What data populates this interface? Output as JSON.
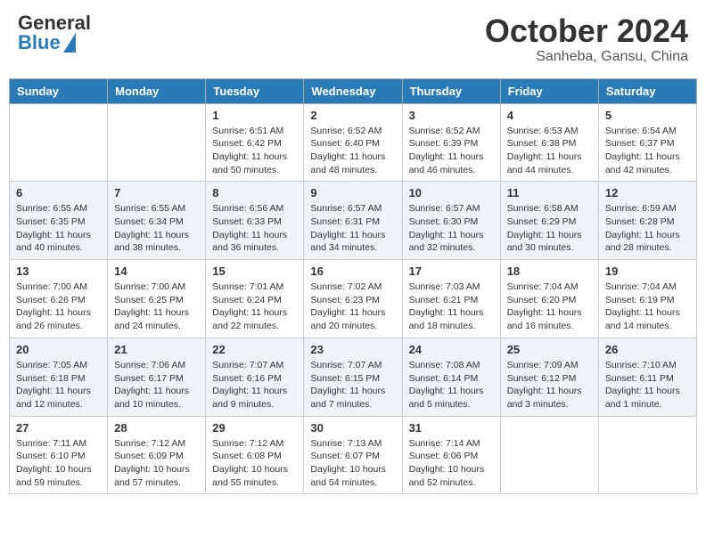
{
  "header": {
    "logo_general": "General",
    "logo_blue": "Blue",
    "month_title": "October 2024",
    "location": "Sanheba, Gansu, China"
  },
  "days_of_week": [
    "Sunday",
    "Monday",
    "Tuesday",
    "Wednesday",
    "Thursday",
    "Friday",
    "Saturday"
  ],
  "weeks": [
    [
      {
        "day": "",
        "info": ""
      },
      {
        "day": "",
        "info": ""
      },
      {
        "day": "1",
        "info": "Sunrise: 6:51 AM\nSunset: 6:42 PM\nDaylight: 11 hours and 50 minutes."
      },
      {
        "day": "2",
        "info": "Sunrise: 6:52 AM\nSunset: 6:40 PM\nDaylight: 11 hours and 48 minutes."
      },
      {
        "day": "3",
        "info": "Sunrise: 6:52 AM\nSunset: 6:39 PM\nDaylight: 11 hours and 46 minutes."
      },
      {
        "day": "4",
        "info": "Sunrise: 6:53 AM\nSunset: 6:38 PM\nDaylight: 11 hours and 44 minutes."
      },
      {
        "day": "5",
        "info": "Sunrise: 6:54 AM\nSunset: 6:37 PM\nDaylight: 11 hours and 42 minutes."
      }
    ],
    [
      {
        "day": "6",
        "info": "Sunrise: 6:55 AM\nSunset: 6:35 PM\nDaylight: 11 hours and 40 minutes."
      },
      {
        "day": "7",
        "info": "Sunrise: 6:55 AM\nSunset: 6:34 PM\nDaylight: 11 hours and 38 minutes."
      },
      {
        "day": "8",
        "info": "Sunrise: 6:56 AM\nSunset: 6:33 PM\nDaylight: 11 hours and 36 minutes."
      },
      {
        "day": "9",
        "info": "Sunrise: 6:57 AM\nSunset: 6:31 PM\nDaylight: 11 hours and 34 minutes."
      },
      {
        "day": "10",
        "info": "Sunrise: 6:57 AM\nSunset: 6:30 PM\nDaylight: 11 hours and 32 minutes."
      },
      {
        "day": "11",
        "info": "Sunrise: 6:58 AM\nSunset: 6:29 PM\nDaylight: 11 hours and 30 minutes."
      },
      {
        "day": "12",
        "info": "Sunrise: 6:59 AM\nSunset: 6:28 PM\nDaylight: 11 hours and 28 minutes."
      }
    ],
    [
      {
        "day": "13",
        "info": "Sunrise: 7:00 AM\nSunset: 6:26 PM\nDaylight: 11 hours and 26 minutes."
      },
      {
        "day": "14",
        "info": "Sunrise: 7:00 AM\nSunset: 6:25 PM\nDaylight: 11 hours and 24 minutes."
      },
      {
        "day": "15",
        "info": "Sunrise: 7:01 AM\nSunset: 6:24 PM\nDaylight: 11 hours and 22 minutes."
      },
      {
        "day": "16",
        "info": "Sunrise: 7:02 AM\nSunset: 6:23 PM\nDaylight: 11 hours and 20 minutes."
      },
      {
        "day": "17",
        "info": "Sunrise: 7:03 AM\nSunset: 6:21 PM\nDaylight: 11 hours and 18 minutes."
      },
      {
        "day": "18",
        "info": "Sunrise: 7:04 AM\nSunset: 6:20 PM\nDaylight: 11 hours and 16 minutes."
      },
      {
        "day": "19",
        "info": "Sunrise: 7:04 AM\nSunset: 6:19 PM\nDaylight: 11 hours and 14 minutes."
      }
    ],
    [
      {
        "day": "20",
        "info": "Sunrise: 7:05 AM\nSunset: 6:18 PM\nDaylight: 11 hours and 12 minutes."
      },
      {
        "day": "21",
        "info": "Sunrise: 7:06 AM\nSunset: 6:17 PM\nDaylight: 11 hours and 10 minutes."
      },
      {
        "day": "22",
        "info": "Sunrise: 7:07 AM\nSunset: 6:16 PM\nDaylight: 11 hours and 9 minutes."
      },
      {
        "day": "23",
        "info": "Sunrise: 7:07 AM\nSunset: 6:15 PM\nDaylight: 11 hours and 7 minutes."
      },
      {
        "day": "24",
        "info": "Sunrise: 7:08 AM\nSunset: 6:14 PM\nDaylight: 11 hours and 5 minutes."
      },
      {
        "day": "25",
        "info": "Sunrise: 7:09 AM\nSunset: 6:12 PM\nDaylight: 11 hours and 3 minutes."
      },
      {
        "day": "26",
        "info": "Sunrise: 7:10 AM\nSunset: 6:11 PM\nDaylight: 11 hours and 1 minute."
      }
    ],
    [
      {
        "day": "27",
        "info": "Sunrise: 7:11 AM\nSunset: 6:10 PM\nDaylight: 10 hours and 59 minutes."
      },
      {
        "day": "28",
        "info": "Sunrise: 7:12 AM\nSunset: 6:09 PM\nDaylight: 10 hours and 57 minutes."
      },
      {
        "day": "29",
        "info": "Sunrise: 7:12 AM\nSunset: 6:08 PM\nDaylight: 10 hours and 55 minutes."
      },
      {
        "day": "30",
        "info": "Sunrise: 7:13 AM\nSunset: 6:07 PM\nDaylight: 10 hours and 54 minutes."
      },
      {
        "day": "31",
        "info": "Sunrise: 7:14 AM\nSunset: 6:06 PM\nDaylight: 10 hours and 52 minutes."
      },
      {
        "day": "",
        "info": ""
      },
      {
        "day": "",
        "info": ""
      }
    ]
  ]
}
